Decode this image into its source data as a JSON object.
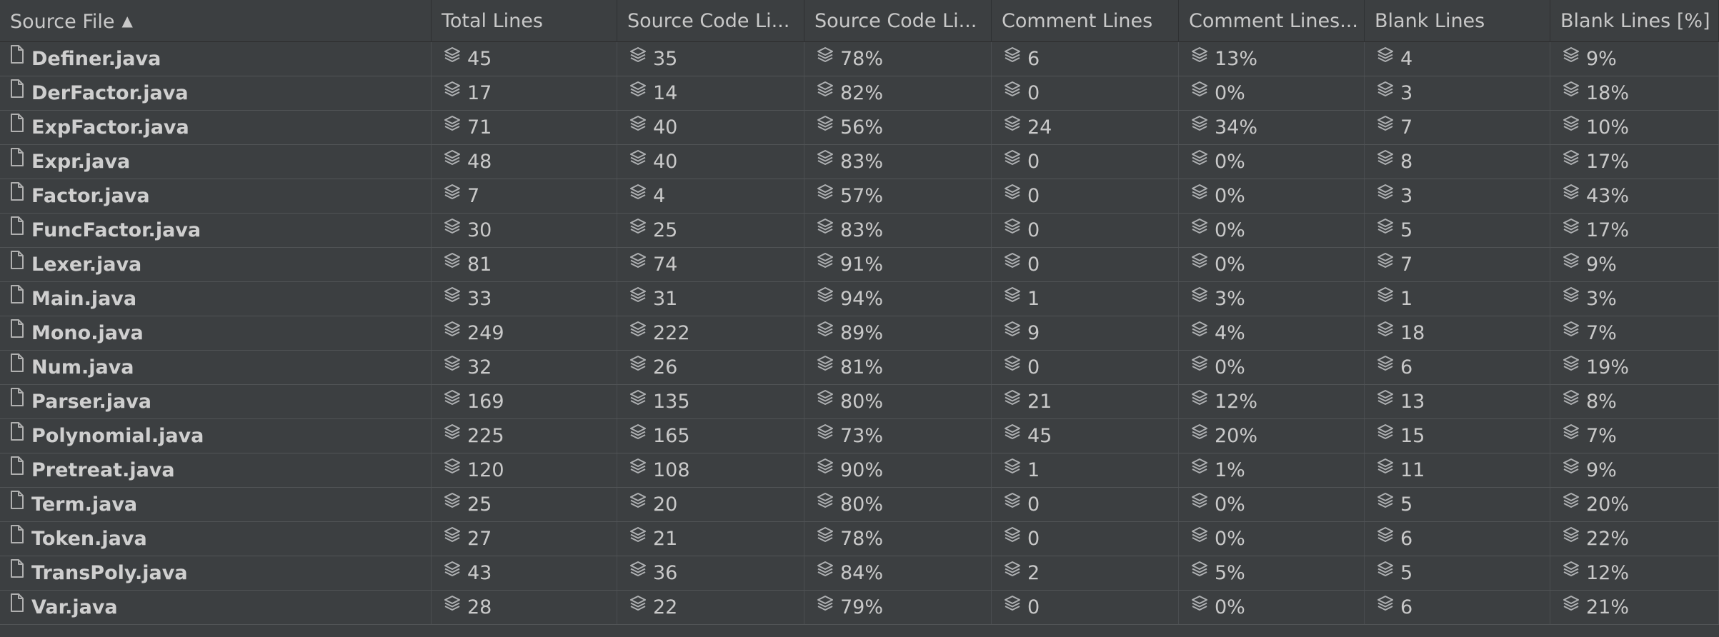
{
  "table": {
    "columns": [
      {
        "label": "Source File",
        "sorted": "ascending"
      },
      {
        "label": "Total Lines"
      },
      {
        "label": "Source Code Li..."
      },
      {
        "label": "Source Code Li..."
      },
      {
        "label": "Comment Lines"
      },
      {
        "label": "Comment Lines..."
      },
      {
        "label": "Blank Lines"
      },
      {
        "label": "Blank Lines [%]"
      }
    ],
    "rows": [
      [
        "Definer.java",
        "45",
        "35",
        "78%",
        "6",
        "13%",
        "4",
        "9%"
      ],
      [
        "DerFactor.java",
        "17",
        "14",
        "82%",
        "0",
        "0%",
        "3",
        "18%"
      ],
      [
        "ExpFactor.java",
        "71",
        "40",
        "56%",
        "24",
        "34%",
        "7",
        "10%"
      ],
      [
        "Expr.java",
        "48",
        "40",
        "83%",
        "0",
        "0%",
        "8",
        "17%"
      ],
      [
        "Factor.java",
        "7",
        "4",
        "57%",
        "0",
        "0%",
        "3",
        "43%"
      ],
      [
        "FuncFactor.java",
        "30",
        "25",
        "83%",
        "0",
        "0%",
        "5",
        "17%"
      ],
      [
        "Lexer.java",
        "81",
        "74",
        "91%",
        "0",
        "0%",
        "7",
        "9%"
      ],
      [
        "Main.java",
        "33",
        "31",
        "94%",
        "1",
        "3%",
        "1",
        "3%"
      ],
      [
        "Mono.java",
        "249",
        "222",
        "89%",
        "9",
        "4%",
        "18",
        "7%"
      ],
      [
        "Num.java",
        "32",
        "26",
        "81%",
        "0",
        "0%",
        "6",
        "19%"
      ],
      [
        "Parser.java",
        "169",
        "135",
        "80%",
        "21",
        "12%",
        "13",
        "8%"
      ],
      [
        "Polynomial.java",
        "225",
        "165",
        "73%",
        "45",
        "20%",
        "15",
        "7%"
      ],
      [
        "Pretreat.java",
        "120",
        "108",
        "90%",
        "1",
        "1%",
        "11",
        "9%"
      ],
      [
        "Term.java",
        "25",
        "20",
        "80%",
        "0",
        "0%",
        "5",
        "20%"
      ],
      [
        "Token.java",
        "27",
        "21",
        "78%",
        "0",
        "0%",
        "6",
        "22%"
      ],
      [
        "TransPoly.java",
        "43",
        "36",
        "84%",
        "2",
        "5%",
        "5",
        "12%"
      ],
      [
        "Var.java",
        "28",
        "22",
        "79%",
        "0",
        "0%",
        "6",
        "21%"
      ]
    ]
  },
  "icons": {
    "file": "file-icon",
    "metric": "layers-icon",
    "sort": "sort-ascending-arrow-icon"
  },
  "colors": {
    "background": "#3c3f41",
    "text": "#c9c9c9",
    "grid": "#515456"
  }
}
